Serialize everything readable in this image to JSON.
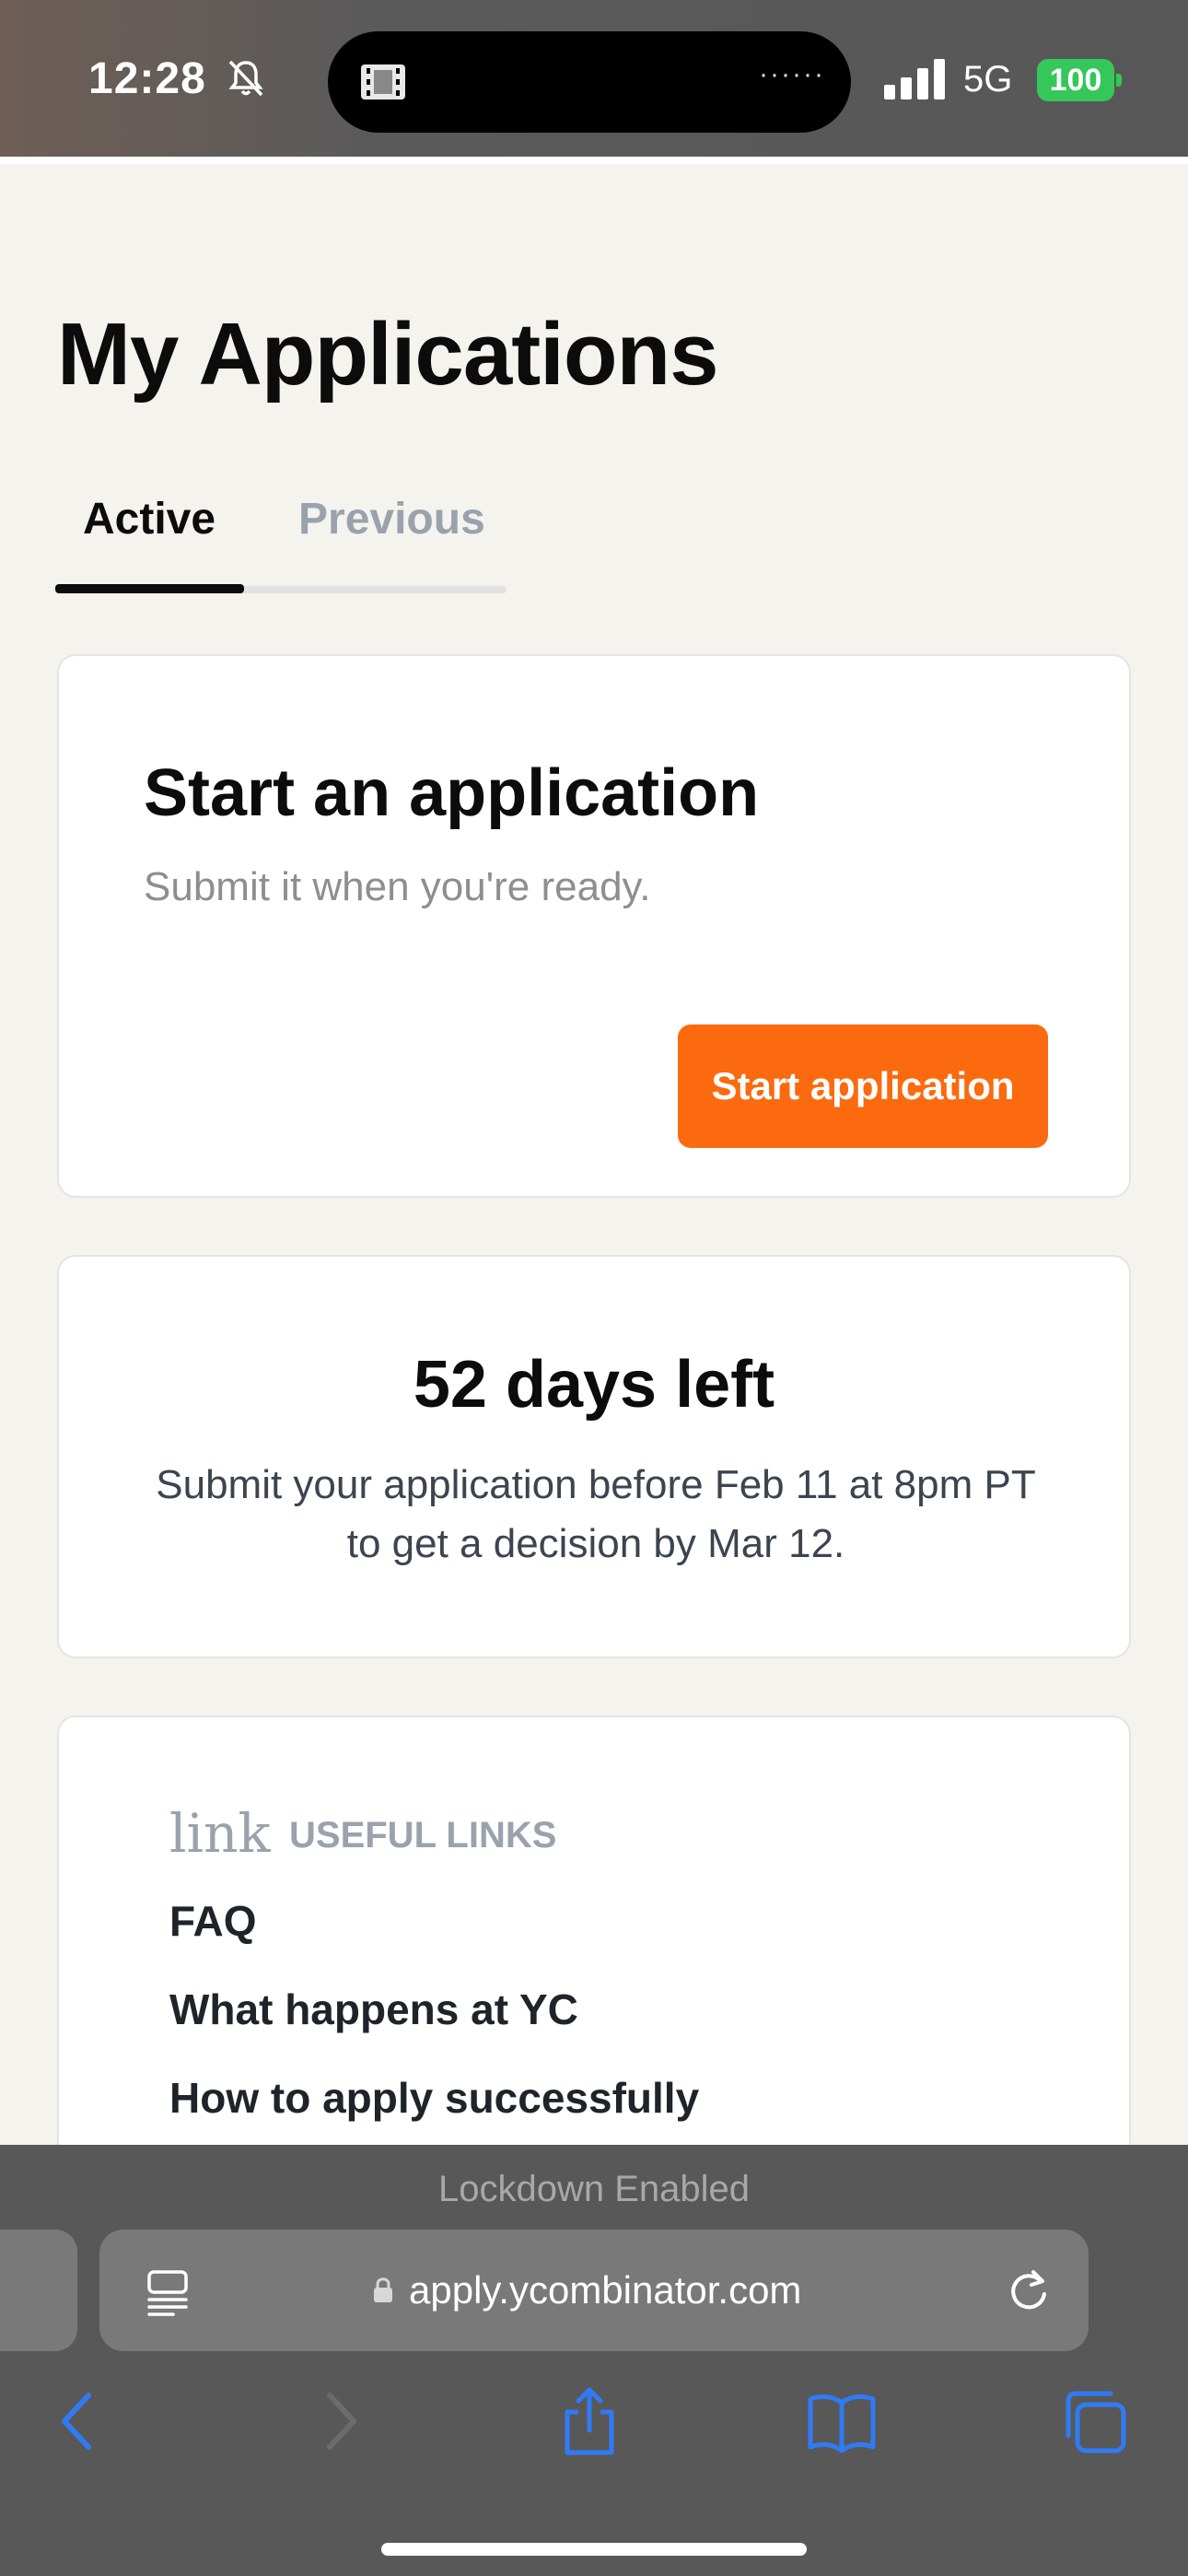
{
  "status_bar": {
    "time": "12:28",
    "network": "5G",
    "battery": "100",
    "icons": [
      "bell-slash-icon",
      "film-icon",
      "signal-bars-icon"
    ]
  },
  "page": {
    "title": "My Applications",
    "tabs": [
      {
        "label": "Active",
        "selected": true
      },
      {
        "label": "Previous",
        "selected": false
      }
    ]
  },
  "start_card": {
    "heading": "Start an application",
    "subtitle": "Submit it when you're ready.",
    "button_label": "Start application"
  },
  "deadline_card": {
    "heading": "52 days left",
    "description": "Submit your application before Feb 11 at 8pm PT to get a decision by Mar 12."
  },
  "links_card": {
    "icon_label": "link",
    "title": "USEFUL LINKS",
    "links": [
      "FAQ",
      "What happens at YC",
      "How to apply successfully"
    ]
  },
  "browser": {
    "lockdown_text": "Lockdown Enabled",
    "url": "apply.ycombinator.com",
    "toolbar_icons": [
      "back-icon",
      "forward-icon",
      "share-icon",
      "bookmarks-icon",
      "tabs-icon"
    ]
  },
  "colors": {
    "accent_orange": "#fb6a0e",
    "page_background": "#f4f3ee",
    "toolbar_blue": "#2f7bf5",
    "battery_green": "#34c759"
  }
}
